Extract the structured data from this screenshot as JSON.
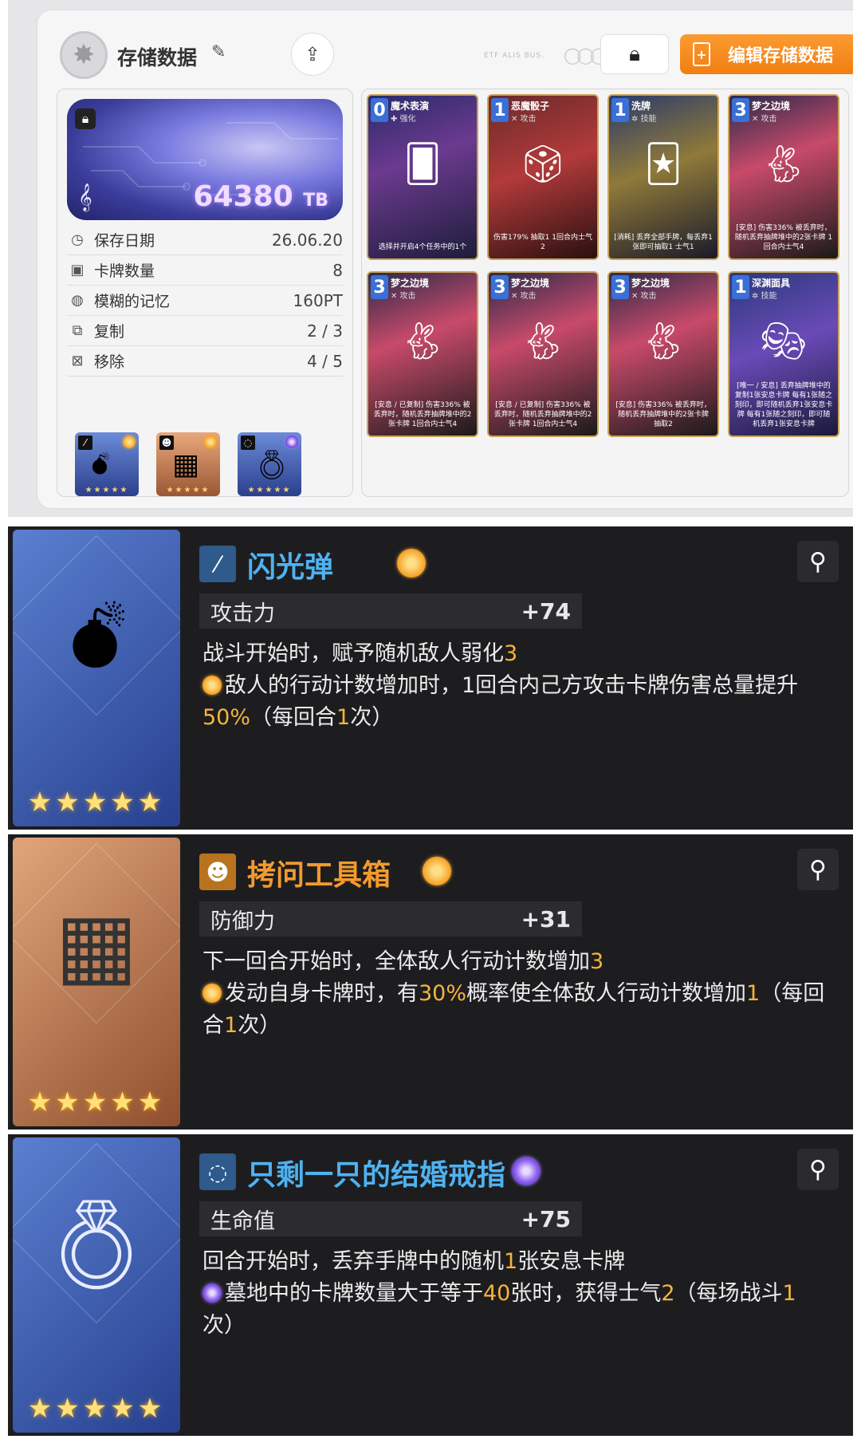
{
  "top": {
    "title": "存储数据",
    "tiny_text": "ETF ALIS BUS.",
    "edit_button": "编辑存储数据",
    "storage": {
      "amount": "64380",
      "unit": "TB"
    },
    "rows": [
      {
        "label": "保存日期",
        "value": "26.06.20",
        "icon": "clock-icon",
        "glyph": "◷"
      },
      {
        "label": "卡牌数量",
        "value": "8",
        "icon": "card-icon",
        "glyph": "▣"
      },
      {
        "label": "模糊的记忆",
        "value": "160PT",
        "icon": "brain-icon",
        "glyph": "◍"
      },
      {
        "label": "复制",
        "value": "2 / 3",
        "icon": "copy-icon",
        "glyph": "⧉"
      },
      {
        "label": "移除",
        "value": "4 / 5",
        "icon": "remove-icon",
        "glyph": "⊠"
      }
    ],
    "equips": [
      {
        "stars": "★★★★★"
      },
      {
        "stars": "★★★★★"
      },
      {
        "stars": "★★★★★"
      }
    ],
    "cards": [
      {
        "cost": "0",
        "name": "魔术表演",
        "type": "✚ 强化",
        "desc": "选择并开启4个任务中的1个"
      },
      {
        "cost": "1",
        "name": "恶魔骰子",
        "type": "✕ 攻击",
        "desc": "伤害179% 抽取1 1回合内士气2"
      },
      {
        "cost": "1",
        "name": "洗牌",
        "type": "✲ 技能",
        "desc": "[消耗] 丢弃全部手牌，每丢弃1张即可抽取1 士气1"
      },
      {
        "cost": "3",
        "name": "梦之边境",
        "type": "✕ 攻击",
        "desc": "[安息] 伤害336% 被丢弃时，随机丢弃抽牌堆中的2张卡牌 1回合内士气4"
      },
      {
        "cost": "3",
        "name": "梦之边境",
        "type": "✕ 攻击",
        "desc": "[安息 / 已复制] 伤害336% 被丢弃时，随机丢弃抽牌堆中的2张卡牌 1回合内士气4"
      },
      {
        "cost": "3",
        "name": "梦之边境",
        "type": "✕ 攻击",
        "desc": "[安息 / 已复制] 伤害336% 被丢弃时，随机丢弃抽牌堆中的2张卡牌 1回合内士气4"
      },
      {
        "cost": "3",
        "name": "梦之边境",
        "type": "✕ 攻击",
        "desc": "[安息] 伤害336% 被丢弃时，随机丢弃抽牌堆中的2张卡牌 抽取2"
      },
      {
        "cost": "1",
        "name": "深渊面具",
        "type": "✲ 技能",
        "desc": "[唯一 / 安息] 丢弃抽牌堆中的复制1张安息卡牌 每有1张随之刻印，即可随机丢弃1张安息卡牌 每有1张随之刻印，即可随机丢弃1张安息卡牌"
      }
    ]
  },
  "items": [
    {
      "name": "闪光弹",
      "stat_label": "攻击力",
      "stat_value": "+74",
      "stars": "★★★★★",
      "line1_a": "战斗开始时，赋予随机敌人弱化",
      "line1_n": "3",
      "line2_a": "敌人的行动计数增加时，1回合内己方攻击卡牌伤害总量提升",
      "line2_n": "50%",
      "line2_b": "（每回合",
      "line2_n2": "1",
      "line2_c": "次）"
    },
    {
      "name": "拷问工具箱",
      "stat_label": "防御力",
      "stat_value": "+31",
      "stars": "★★★★★",
      "line1_a": "下一回合开始时，全体敌人行动计数增加",
      "line1_n": "3",
      "line2_a": "发动自身卡牌时，有",
      "line2_n": "30%",
      "line2_b": "概率使全体敌人行动计数增加",
      "line2_n2": "1",
      "line2_c": "（每回合",
      "line2_n3": "1",
      "line2_d": "次）"
    },
    {
      "name": "只剩一只的结婚戒指",
      "stat_label": "生命值",
      "stat_value": "+75",
      "stars": "★★★★★",
      "line1_a": "回合开始时，丢弃手牌中的随机",
      "line1_n": "1",
      "line1_b": "张安息卡牌",
      "line2_a": "墓地中的卡牌数量大于等于",
      "line2_n": "40",
      "line2_b": "张时，获得士气",
      "line2_n2": "2",
      "line2_c": "（每场战斗",
      "line2_n3": "1",
      "line2_d": "次）"
    }
  ],
  "colors": {
    "orange": "#f6b43a",
    "sun": "#f4a021",
    "moon": "#8b5cf0",
    "item_bg": "#1d1d20",
    "name_blue": "#4fb2f0",
    "name_orange": "#f39a2e"
  }
}
